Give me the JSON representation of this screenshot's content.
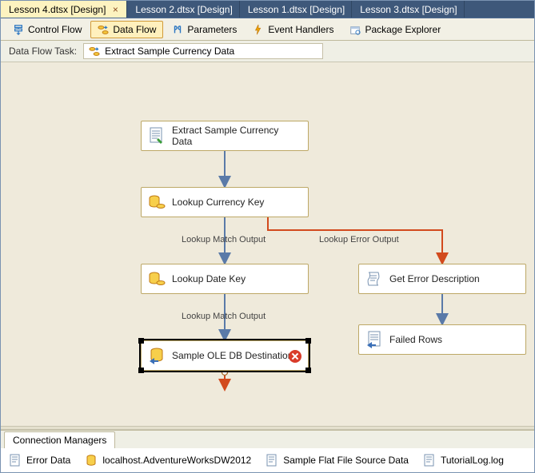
{
  "tabs": {
    "items": [
      {
        "label": "Lesson 4.dtsx [Design]",
        "active": true
      },
      {
        "label": "Lesson 2.dtsx [Design]",
        "active": false
      },
      {
        "label": "Lesson 1.dtsx [Design]",
        "active": false
      },
      {
        "label": "Lesson 3.dtsx [Design]",
        "active": false
      }
    ]
  },
  "toolbar": {
    "control_flow": "Control Flow",
    "data_flow": "Data Flow",
    "parameters": "Parameters",
    "event_handlers": "Event Handlers",
    "package_explorer": "Package Explorer"
  },
  "task": {
    "label": "Data Flow Task:",
    "name": "Extract Sample Currency Data"
  },
  "nodes": {
    "extract": "Extract Sample Currency Data",
    "lookup_currency": "Lookup Currency Key",
    "lookup_date": "Lookup Date Key",
    "sample_dest": "Sample OLE DB Destination",
    "get_error": "Get Error Description",
    "failed_rows": "Failed Rows"
  },
  "edges": {
    "match1": "Lookup Match Output",
    "match2": "Lookup Match Output",
    "error1": "Lookup Error Output"
  },
  "bottom_panel": {
    "tab": "Connection Managers",
    "items": {
      "error_data": "Error Data",
      "db": "localhost.AdventureWorksDW2012",
      "flat_file": "Sample Flat File Source Data",
      "tutorial": "TutorialLog.log"
    }
  }
}
